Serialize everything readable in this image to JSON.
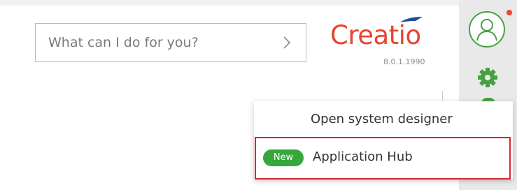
{
  "command_line": {
    "placeholder": "What can I do for you?"
  },
  "logo": {
    "text": "Creatio"
  },
  "version": "8.0.1.1990",
  "profile": {
    "notification_color": "#f0452c"
  },
  "colors": {
    "brand": "#e8442e",
    "accent_green": "#46a142",
    "highlight_red": "#d7282f"
  },
  "menu": {
    "items": [
      {
        "label": "Open system designer"
      },
      {
        "badge": "New",
        "label": "Application Hub"
      }
    ]
  },
  "icons": {
    "command_arrow": "chevron-right-icon",
    "avatar": "user-icon",
    "settings": "gear-icon"
  }
}
